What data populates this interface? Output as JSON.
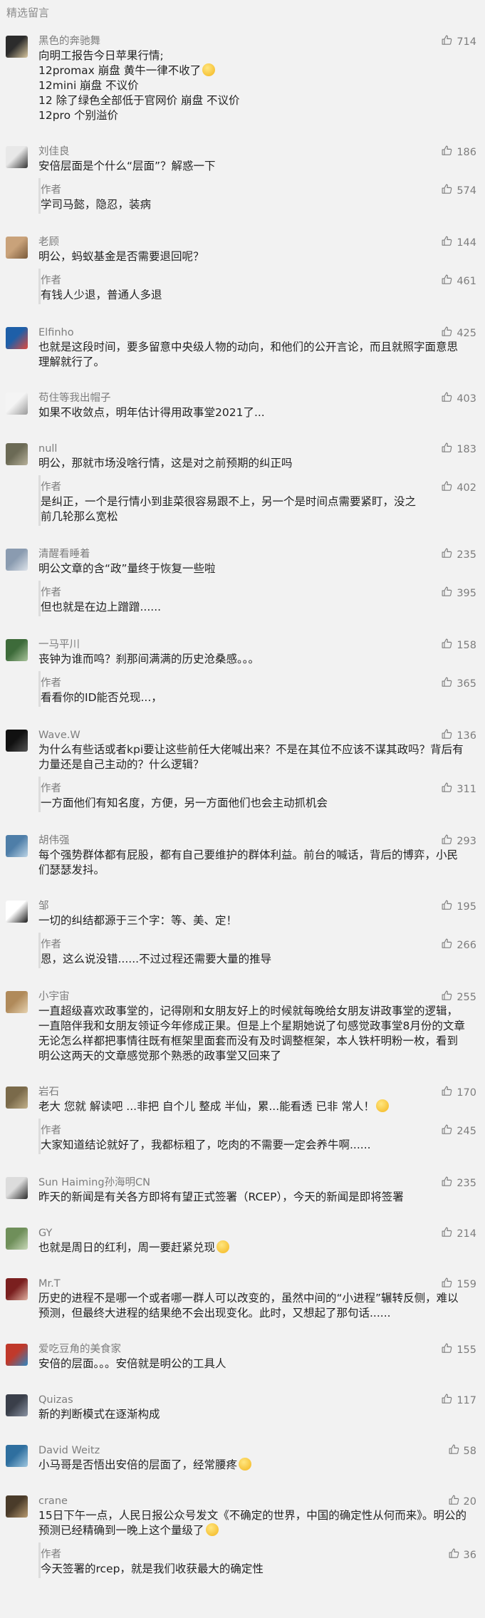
{
  "section_title": "精选留言",
  "author_label": "作者",
  "comments": [
    {
      "nick": "黑色的奔驰舞",
      "likes": "714",
      "lines": [
        "向明工报告今日苹果行情;",
        "12promax  崩盘 黄牛一律不收了",
        "12mini  崩盘  不议价",
        "12   除了绿色全部低于官网价  崩盘  不议价",
        "12pro  个别溢价"
      ],
      "emoji_line": 1,
      "avatar": [
        "#2c2c2c",
        "#d9c7a0"
      ]
    },
    {
      "nick": "刘佳良",
      "likes": "186",
      "lines": [
        "安倍层面是个什么“层面”？解惑一下"
      ],
      "reply": {
        "text": [
          "学司马懿，隐忍，装病"
        ],
        "likes": "574"
      },
      "avatar": [
        "#e8e8e8",
        "#333333"
      ]
    },
    {
      "nick": "老顾",
      "likes": "144",
      "lines": [
        "明公，蚂蚁基金是否需要退回呢？"
      ],
      "reply": {
        "text": [
          "有钱人少退，普通人多退"
        ],
        "likes": "461"
      },
      "avatar": [
        "#c9a27a",
        "#7a5a3a"
      ]
    },
    {
      "nick": "Elfinho",
      "likes": "425",
      "lines": [
        "也就是这段时间，要多留意中央级人物的动向，和他们的公开言论，而且就照字面意思理解就行了。"
      ],
      "avatar": [
        "#1e5fa8",
        "#e04a3c"
      ]
    },
    {
      "nick": "苟住等我出帽子",
      "likes": "403",
      "lines": [
        "如果不收敛点，明年估计得用政事堂2021了..."
      ],
      "avatar": [
        "#f4f4f4",
        "#9a9a9a"
      ]
    },
    {
      "nick": "null",
      "likes": "183",
      "lines": [
        "明公，那就市场没啥行情，这是对之前预期的纠正吗"
      ],
      "reply": {
        "text": [
          "是纠正，一个是行情小到韭菜很容易跟不上，另一个是时间点需要紧盯，没之前几轮那么宽松"
        ],
        "likes": "402"
      },
      "avatar": [
        "#6b6a55",
        "#b7b19a"
      ]
    },
    {
      "nick": "清醒看睡着",
      "likes": "235",
      "lines": [
        "明公文章的含“政”量终于恢复一些啦"
      ],
      "reply": {
        "text": [
          "但也就是在边上蹭蹭......"
        ],
        "likes": "395"
      },
      "avatar": [
        "#8a9bb0",
        "#dde3ea"
      ]
    },
    {
      "nick": "一马平川",
      "likes": "158",
      "lines": [
        "丧钟为谁而鸣？刹那间满满的历史沧桑感。。。"
      ],
      "reply": {
        "text": [
          "看看你的ID能否兑现...，"
        ],
        "likes": "365"
      },
      "avatar": [
        "#3d6b3a",
        "#a8c39a"
      ]
    },
    {
      "nick": "Wave.W",
      "likes": "136",
      "lines": [
        "为什么有些话或者kpi要让这些前任大佬喊出来？不是在其位不应该不谋其政吗？背后有力量还是自己主动的？什么逻辑？"
      ],
      "reply": {
        "text": [
          "一方面他们有知名度，方便，另一方面他们也会主动抓机会"
        ],
        "likes": "311"
      },
      "avatar": [
        "#111111",
        "#555555"
      ]
    },
    {
      "nick": "胡伟强",
      "likes": "293",
      "lines": [
        "每个强势群体都有屁股，都有自己要维护的群体利益。前台的喊话，背后的博弈，小民们瑟瑟发抖。"
      ],
      "avatar": [
        "#4e7ea8",
        "#bcd4e6"
      ]
    },
    {
      "nick": "邹",
      "likes": "195",
      "lines": [
        "一切的纠结都源于三个字：等、美、定！"
      ],
      "reply": {
        "text": [
          "恩，这么说没错......不过过程还需要大量的推导"
        ],
        "likes": "266"
      },
      "avatar": [
        "#ffffff",
        "#1a1a1a"
      ]
    },
    {
      "nick": "小宇宙",
      "likes": "255",
      "lines": [
        "一直超级喜欢政事堂的，记得刚和女朋友好上的时候就每晚给女朋友讲政事堂的逻辑，一直陪伴我和女朋友领证今年修成正果。但是上个星期她说了句感觉政事堂8月份的文章无论怎么样都把事情往既有框架里面套而没有及时调整框架，本人铁杆明粉一枚，看到明公这两天的文章感觉那个熟悉的政事堂又回来了"
      ],
      "avatar": [
        "#b08a5a",
        "#e6d2b0"
      ]
    },
    {
      "nick": "岩石",
      "likes": "170",
      "lines": [
        "老大 您就 解读吧  ...非把 自个儿 整成 半仙，累...能看透 已非 常人！"
      ],
      "emoji_line": 0,
      "reply": {
        "text": [
          "大家知道结论就好了，我都标粗了，吃肉的不需要一定会养牛啊......"
        ],
        "likes": "245"
      },
      "avatar": [
        "#7a6a4a",
        "#c2b08a"
      ]
    },
    {
      "nick": "Sun Haiming孙海明CN",
      "likes": "235",
      "lines": [
        "昨天的新闻是有关各方即将有望正式签署（RCEP），今天的新闻是即将签署"
      ],
      "avatar": [
        "#dcdcdc",
        "#2a2a2a"
      ]
    },
    {
      "nick": "GY",
      "likes": "214",
      "lines": [
        "也就是周日的红利，周一要赶紧兑现"
      ],
      "emoji_line": 0,
      "avatar": [
        "#6f8f5a",
        "#c8d8b8"
      ]
    },
    {
      "nick": "Mr.T",
      "likes": "159",
      "lines": [
        "历史的进程不是哪一个或者哪一群人可以改变的，虽然中间的“小进程”辗转反侧，难以预测，但最终大进程的结果绝不会出现变化。此时，又想起了那句话......"
      ],
      "avatar": [
        "#7a1f1f",
        "#e0b0a0"
      ]
    },
    {
      "nick": "爱吃豆角的美食家",
      "likes": "155",
      "lines": [
        "安倍的层面。。。安倍就是明公的工具人"
      ],
      "avatar": [
        "#c0392b",
        "#2e86c1"
      ]
    },
    {
      "nick": "Quizas",
      "likes": "117",
      "lines": [
        "新的判断模式在逐渐构成"
      ],
      "avatar": [
        "#3a3f4a",
        "#8a93a3"
      ]
    },
    {
      "nick": "David Weitz",
      "likes": "58",
      "lines": [
        "小马哥是否悟出安倍的层面了，经常腰疼"
      ],
      "emoji_line": 0,
      "avatar": [
        "#2f6f9f",
        "#9fc7e0"
      ]
    },
    {
      "nick": "crane",
      "likes": "20",
      "lines": [
        "15日下午一点，人民日报公众号发文《不确定的世界，中国的确定性从何而来》。明公的预测已经精确到一晚上这个量级了"
      ],
      "emoji_line": 0,
      "reply": {
        "text": [
          "今天签署的rcep，就是我们收获最大的确定性"
        ],
        "likes": "36"
      },
      "avatar": [
        "#4a3b2a",
        "#b89a70"
      ]
    }
  ]
}
